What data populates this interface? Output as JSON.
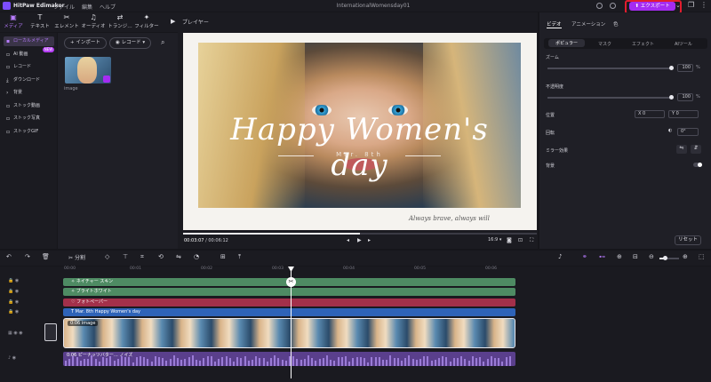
{
  "app": {
    "name": "HitPaw Edimakor",
    "menu": [
      "ファイル",
      "編集",
      "ヘルプ"
    ],
    "window_title": "InternationalWomensday01",
    "export_label": "エクスポート"
  },
  "toolbar": {
    "tabs": [
      "メディア",
      "テキスト",
      "エレメント",
      "オーディオ",
      "トランジ…",
      "フィルター"
    ]
  },
  "sidebar": {
    "items": [
      "ローカルメディア",
      "AI 動画",
      "レコード",
      "ダウンロード",
      "背景",
      "ストック動画",
      "ストック写真",
      "ストックGIF"
    ],
    "new_badge": "NEW"
  },
  "media": {
    "import_label": "インポート",
    "record_label": "レコード",
    "thumb_label": "image"
  },
  "player": {
    "header": "プレイヤー",
    "title_text": "Happy Women's day",
    "date_text": "Mar. 8th",
    "signature": "Always brave, always will",
    "current_time": "00:03:07",
    "total_time": "00:06:12",
    "time_sep": "/",
    "aspect": "16:9",
    "progress_ratio": 0.5
  },
  "inspector": {
    "tabs": [
      "ビデオ",
      "アニメーション",
      "色"
    ],
    "subtabs": [
      "ポピュラー",
      "マスク",
      "エフェクト",
      "AIツール"
    ],
    "zoom_label": "ズーム",
    "zoom_value": "100",
    "zoom_level": 1.0,
    "opacity_label": "不透明度",
    "opacity_value": "100",
    "opacity_level": 1.0,
    "position_label": "位置",
    "pos_x_label": "X",
    "pos_x": "0",
    "pos_y_label": "Y",
    "pos_y": "0",
    "rotation_label": "回転",
    "rotation_value": "0°",
    "mirror_label": "ミラー効果",
    "background_label": "背景",
    "reset_label": "リセット",
    "percent": "%"
  },
  "timeline_toolbar": {
    "split_label": "分割"
  },
  "timeline": {
    "ruler": [
      "00:00",
      "00:01",
      "00:02",
      "00:03",
      "00:04",
      "00:05",
      "00:06"
    ],
    "tracks": [
      {
        "label": "ネイチャー スキン",
        "color": "#4e8b63"
      },
      {
        "label": "ブライトホワイト",
        "color": "#4e8b63"
      },
      {
        "label": "フォトペーパー",
        "color": "#a3304a"
      },
      {
        "label": "Mar. 8th  Happy Women's day",
        "color": "#2e63b8"
      }
    ],
    "video_clip_label": "0:06 image",
    "audio_clip_label": "0:06 ピーナッツバター… ノイズ"
  },
  "colors": {
    "accent": "#b87cff",
    "export_bg": "#a52bf2",
    "highlight_box": "#e21d2e"
  }
}
